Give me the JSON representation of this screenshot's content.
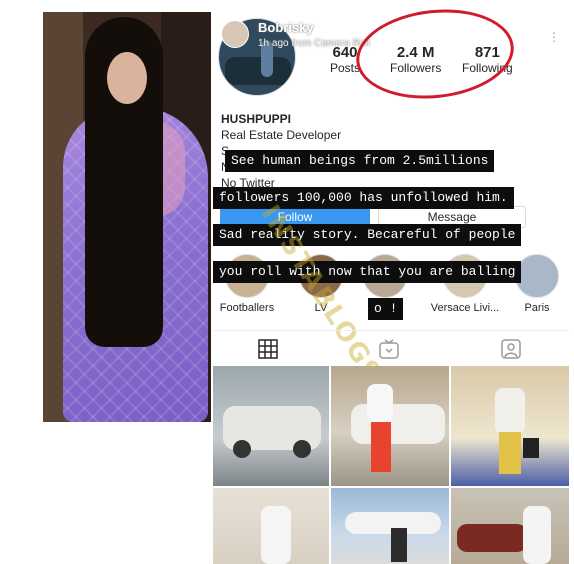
{
  "profile": {
    "story_username": "Bobrisky",
    "story_meta": "1h ago from Camera Roll",
    "posts_count": "640",
    "posts_label": "Posts",
    "followers_count": "2.4 M",
    "followers_label": "Followers",
    "following_count": "871",
    "following_label": "Following",
    "name": "HUSHPUPPI",
    "bio_line1": "Real Estate Developer",
    "bio_line2": "S",
    "bio_line3": "N",
    "bio_line4": "No Twitter",
    "follow_label": "Follow",
    "message_label": "Message"
  },
  "highlights": [
    {
      "label": "Footballers"
    },
    {
      "label": "LV"
    },
    {
      "label": ""
    },
    {
      "label": "Versace Livi..."
    },
    {
      "label": "Paris"
    }
  ],
  "caption": {
    "line1": "See human beings from 2.5millions",
    "line2": "followers 100,000 has unfollowed him.",
    "line3": "Sad reality story. Becareful of people",
    "line4": "you roll with now that you are balling",
    "line5": "o !"
  },
  "watermark": "INSTABLOG9JA",
  "tabs": [
    {
      "icon": "grid-icon"
    },
    {
      "icon": "igtv-icon"
    },
    {
      "icon": "tagged-icon"
    }
  ],
  "colors": {
    "follow_blue": "#3897f0",
    "ring_red": "#d11a2a",
    "dress_purple": "#8b6fd1"
  }
}
